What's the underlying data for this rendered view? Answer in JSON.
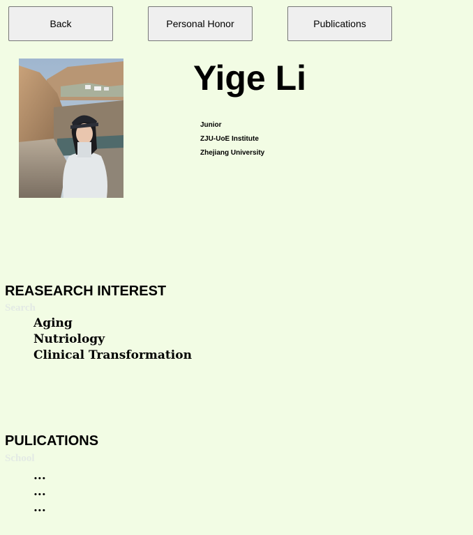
{
  "nav": {
    "back_label": "Back",
    "honor_label": "Personal Honor",
    "publications_label": "Publications"
  },
  "profile": {
    "name": "Yige Li",
    "details": [
      "Junior",
      "ZJU-UoE Institute",
      "Zhejiang University"
    ]
  },
  "research": {
    "title": "REASEARCH INTEREST",
    "ghost": "Search",
    "items": [
      "Aging",
      "Nutriology",
      "Clinical Transformation"
    ]
  },
  "publications": {
    "title": "PULICATIONS",
    "ghost": "School",
    "items": [
      "...",
      "...",
      "..."
    ]
  },
  "colors": {
    "background": "#f2fce4",
    "button": "#efefef"
  }
}
